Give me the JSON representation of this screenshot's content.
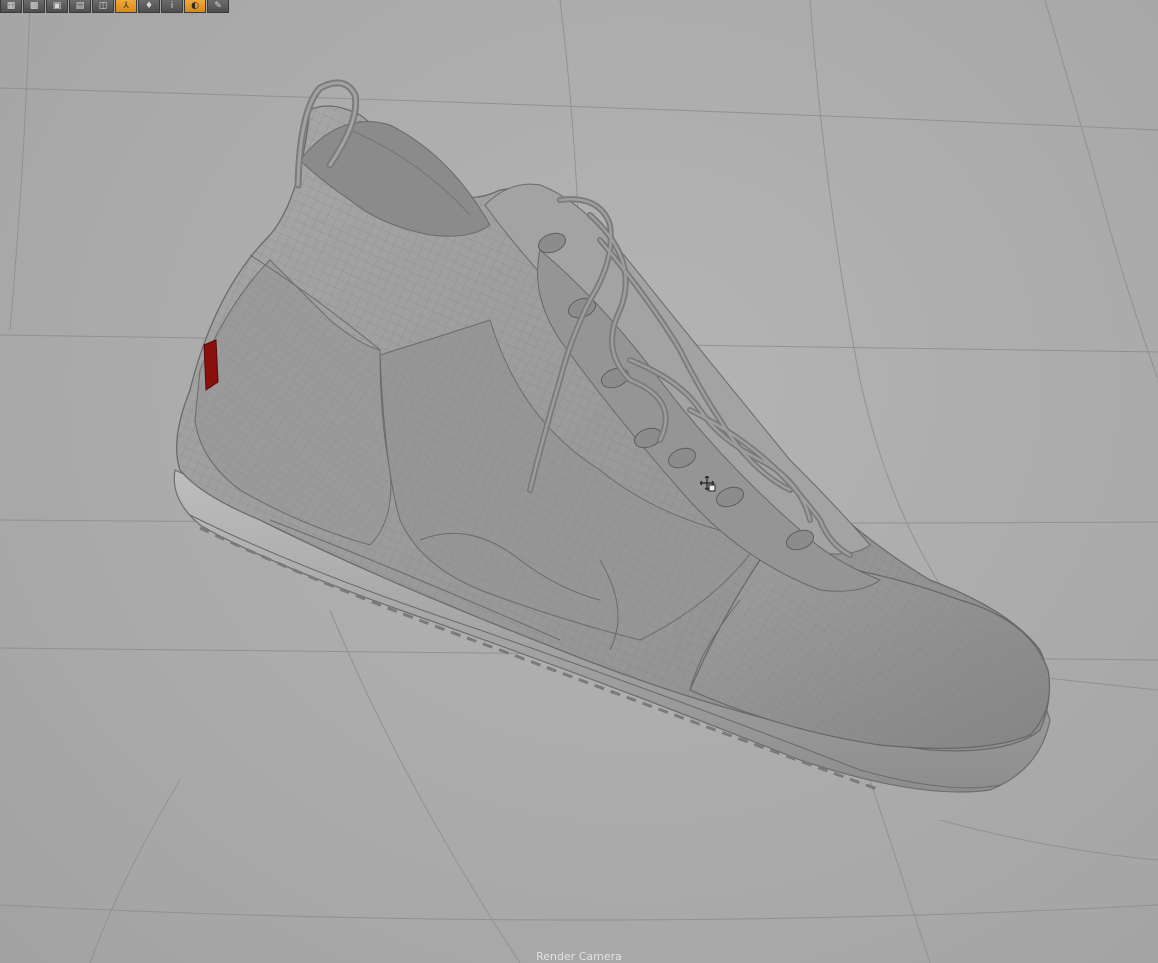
{
  "toolbar": {
    "tools": [
      {
        "icon": "grid-icon",
        "glyph": "▦"
      },
      {
        "icon": "texture-icon",
        "glyph": "▩"
      },
      {
        "icon": "wireframe-icon",
        "glyph": "▣"
      },
      {
        "icon": "mesh-icon",
        "glyph": "▤"
      },
      {
        "icon": "camera-icon",
        "glyph": "◫"
      },
      {
        "icon": "axis-icon",
        "glyph": "⅄",
        "active": true
      },
      {
        "icon": "light-icon",
        "glyph": "♦"
      },
      {
        "icon": "info-icon",
        "glyph": "i"
      },
      {
        "icon": "shading-icon",
        "glyph": "◐",
        "active": true
      },
      {
        "icon": "paint-icon",
        "glyph": "✎"
      }
    ]
  },
  "viewport": {
    "camera_label": "Render Camera"
  },
  "colors": {
    "background": "#a9a9a9",
    "model_surface": "#9c9c9c",
    "wire": "#7a7a7a",
    "accent_tag": "#8a1010",
    "active_tool": "#e89a28"
  }
}
